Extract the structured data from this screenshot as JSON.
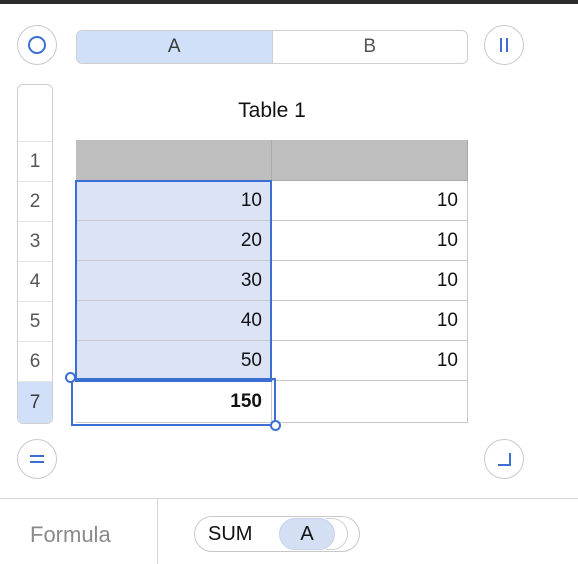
{
  "controls": {
    "select_all_icon": "circle-icon",
    "freeze_columns_icon": "column-bars-icon",
    "freeze_rows_icon": "equals-icon",
    "resize_icon": "corner-resize-icon",
    "accent_color": "#3b6fd4",
    "selection_color": "#d0e0f8"
  },
  "columns": [
    {
      "label": "A",
      "selected": true
    },
    {
      "label": "B",
      "selected": false
    }
  ],
  "rows": [
    {
      "label": "1",
      "selected": false
    },
    {
      "label": "2",
      "selected": false
    },
    {
      "label": "3",
      "selected": false
    },
    {
      "label": "4",
      "selected": false
    },
    {
      "label": "5",
      "selected": false
    },
    {
      "label": "6",
      "selected": false
    },
    {
      "label": "7",
      "selected": true
    }
  ],
  "table": {
    "title": "Table 1",
    "header_row": [
      "",
      ""
    ],
    "body": [
      [
        "10",
        "10"
      ],
      [
        "20",
        "10"
      ],
      [
        "30",
        "10"
      ],
      [
        "40",
        "10"
      ],
      [
        "50",
        "10"
      ],
      [
        "150",
        ""
      ]
    ]
  },
  "formula": {
    "label": "Formula",
    "function": "SUM",
    "argument": "A"
  }
}
